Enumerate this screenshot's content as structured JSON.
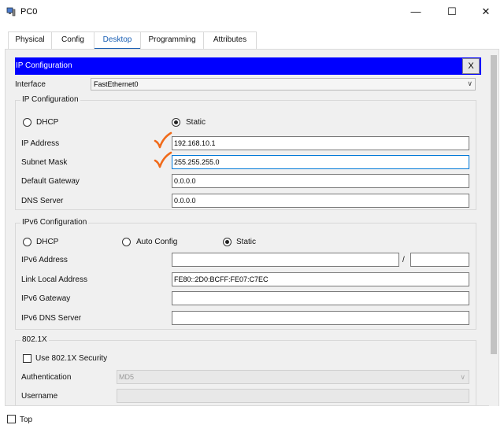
{
  "window": {
    "title": "PC0",
    "minimize_glyph": "—",
    "maximize_glyph": "☐",
    "close_glyph": "✕"
  },
  "tabs": [
    {
      "label": "Physical"
    },
    {
      "label": "Config"
    },
    {
      "label": "Desktop"
    },
    {
      "label": "Programming"
    },
    {
      "label": "Attributes"
    }
  ],
  "active_tab": "Desktop",
  "ip_panel": {
    "title": "IP Configuration",
    "close_label": "X",
    "interface_label": "Interface",
    "interface_value": "FastEthernet0"
  },
  "ipv4": {
    "group_title": "IP Configuration",
    "dhcp_label": "DHCP",
    "static_label": "Static",
    "mode": "Static",
    "ip_label": "IP Address",
    "ip_value": "192.168.10.1",
    "mask_label": "Subnet Mask",
    "mask_value": "255.255.255.0",
    "gateway_label": "Default Gateway",
    "gateway_value": "0.0.0.0",
    "dns_label": "DNS Server",
    "dns_value": "0.0.0.0"
  },
  "ipv6": {
    "group_title": "IPv6 Configuration",
    "dhcp_label": "DHCP",
    "auto_label": "Auto Config",
    "static_label": "Static",
    "mode": "Static",
    "address_label": "IPv6 Address",
    "address_value": "",
    "prefix_separator": "/",
    "prefix_value": "",
    "link_local_label": "Link Local Address",
    "link_local_value": "FE80::2D0:BCFF:FE07:C7EC",
    "gateway_label": "IPv6 Gateway",
    "gateway_value": "",
    "dns_label": "IPv6 DNS Server",
    "dns_value": ""
  },
  "dot1x": {
    "group_title": "802.1X",
    "use_label": "Use 802.1X Security",
    "auth_label": "Authentication",
    "auth_value": "MD5",
    "username_label": "Username",
    "username_value": ""
  },
  "footer": {
    "top_label": "Top"
  },
  "annotation": {
    "color": "#f06a1a",
    "icon": "handwritten-checkmark"
  }
}
